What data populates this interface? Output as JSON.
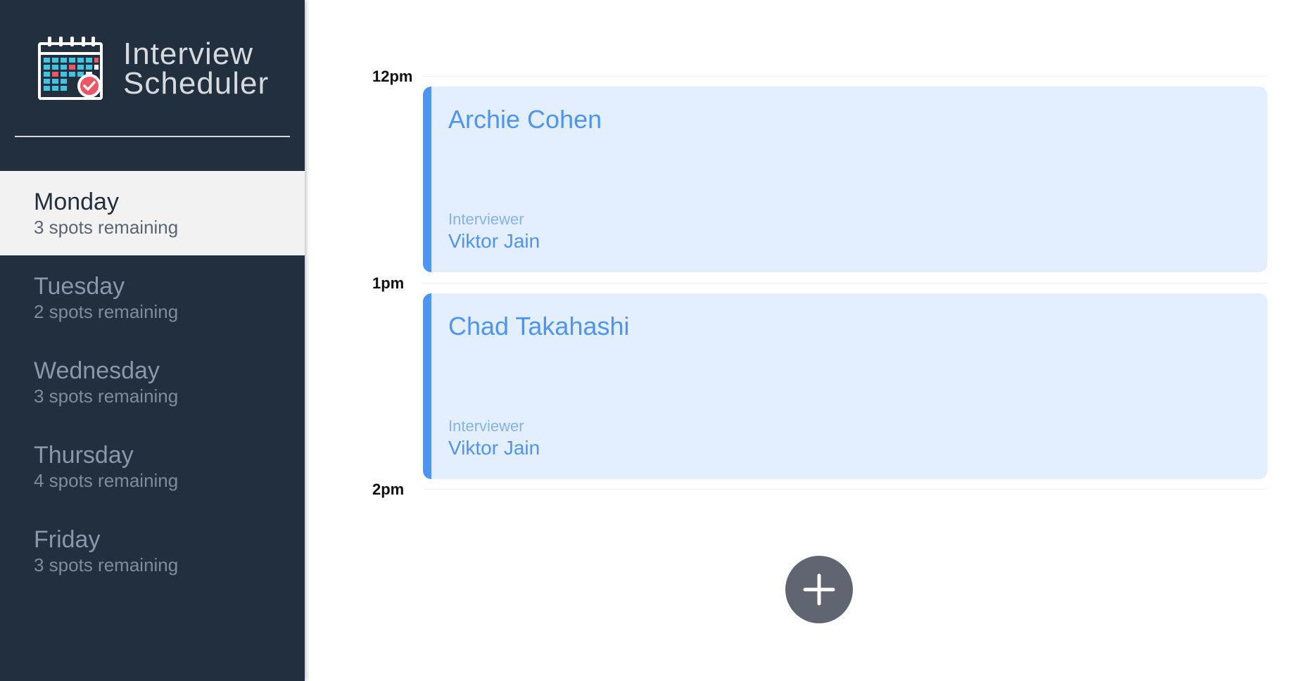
{
  "app": {
    "title_line1": "Interview",
    "title_line2": "Scheduler",
    "logo_icon": "calendar-check-icon"
  },
  "sidebar": {
    "days": [
      {
        "name": "Monday",
        "spots": "3 spots remaining",
        "selected": true
      },
      {
        "name": "Tuesday",
        "spots": "2 spots remaining",
        "selected": false
      },
      {
        "name": "Wednesday",
        "spots": "3 spots remaining",
        "selected": false
      },
      {
        "name": "Thursday",
        "spots": "4 spots remaining",
        "selected": false
      },
      {
        "name": "Friday",
        "spots": "3 spots remaining",
        "selected": false
      }
    ]
  },
  "schedule": {
    "slots": [
      {
        "time": "12pm",
        "student": "Archie Cohen",
        "interviewer_label": "Interviewer",
        "interviewer": "Viktor Jain"
      },
      {
        "time": "1pm",
        "student": "Chad Takahashi",
        "interviewer_label": "Interviewer",
        "interviewer": "Viktor Jain"
      },
      {
        "time": "2pm"
      }
    ],
    "add_icon": "plus-icon"
  },
  "colors": {
    "sidebar_bg": "#222f3e",
    "selected_day_bg": "#f2f2f2",
    "appointment_bg": "#e3efff",
    "accent_blue": "#4e94f2",
    "add_button_bg": "#5f6672"
  }
}
